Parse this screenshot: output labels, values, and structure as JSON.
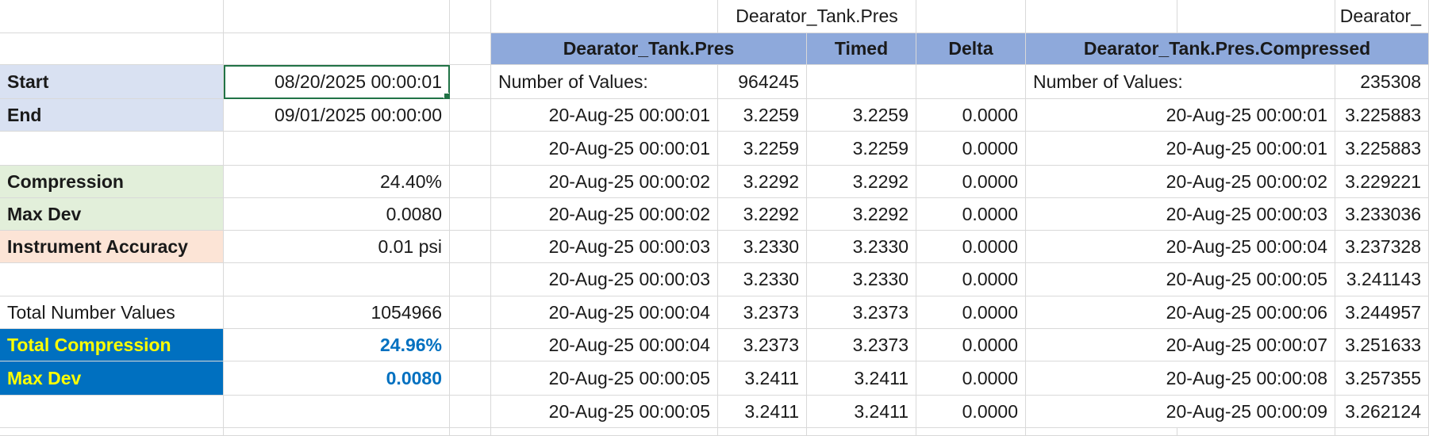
{
  "top_title_1": "Dearator_Tank.Pres",
  "top_title_2": "Dearator_",
  "headers": {
    "tag": "Dearator_Tank.Pres",
    "timed": "Timed",
    "delta": "Delta",
    "compressed": "Dearator_Tank.Pres.Compressed"
  },
  "summary": {
    "start_label": "Start",
    "start_value": "08/20/2025 00:00:01",
    "end_label": "End",
    "end_value": "09/01/2025 00:00:00",
    "compression_label": "Compression",
    "compression_value": "24.40%",
    "maxdev_label": "Max Dev",
    "maxdev_value": "0.0080",
    "accuracy_label": "Instrument Accuracy",
    "accuracy_value": "0.01 psi",
    "total_values_label": "Total Number Values",
    "total_values_value": "1054966",
    "total_compression_label": "Total Compression",
    "total_compression_value": "24.96%",
    "total_maxdev_label": "Max Dev",
    "total_maxdev_value": "0.0080"
  },
  "counts": {
    "label": "Number of Values:",
    "raw": "964245",
    "compressed_label": "Number of Values:",
    "compressed": "235308"
  },
  "rows": [
    {
      "ts": "20-Aug-25 00:00:01",
      "val": "3.2259",
      "timed": "3.2259",
      "delta": "0.0000",
      "cts": "20-Aug-25 00:00:01",
      "cval": "3.225883"
    },
    {
      "ts": "20-Aug-25 00:00:01",
      "val": "3.2259",
      "timed": "3.2259",
      "delta": "0.0000",
      "cts": "20-Aug-25 00:00:01",
      "cval": "3.225883"
    },
    {
      "ts": "20-Aug-25 00:00:02",
      "val": "3.2292",
      "timed": "3.2292",
      "delta": "0.0000",
      "cts": "20-Aug-25 00:00:02",
      "cval": "3.229221"
    },
    {
      "ts": "20-Aug-25 00:00:02",
      "val": "3.2292",
      "timed": "3.2292",
      "delta": "0.0000",
      "cts": "20-Aug-25 00:00:03",
      "cval": "3.233036"
    },
    {
      "ts": "20-Aug-25 00:00:03",
      "val": "3.2330",
      "timed": "3.2330",
      "delta": "0.0000",
      "cts": "20-Aug-25 00:00:04",
      "cval": "3.237328"
    },
    {
      "ts": "20-Aug-25 00:00:03",
      "val": "3.2330",
      "timed": "3.2330",
      "delta": "0.0000",
      "cts": "20-Aug-25 00:00:05",
      "cval": "3.241143"
    },
    {
      "ts": "20-Aug-25 00:00:04",
      "val": "3.2373",
      "timed": "3.2373",
      "delta": "0.0000",
      "cts": "20-Aug-25 00:00:06",
      "cval": "3.244957"
    },
    {
      "ts": "20-Aug-25 00:00:04",
      "val": "3.2373",
      "timed": "3.2373",
      "delta": "0.0000",
      "cts": "20-Aug-25 00:00:07",
      "cval": "3.251633"
    },
    {
      "ts": "20-Aug-25 00:00:05",
      "val": "3.2411",
      "timed": "3.2411",
      "delta": "0.0000",
      "cts": "20-Aug-25 00:00:08",
      "cval": "3.257355"
    },
    {
      "ts": "20-Aug-25 00:00:05",
      "val": "3.2411",
      "timed": "3.2411",
      "delta": "0.0000",
      "cts": "20-Aug-25 00:00:09",
      "cval": "3.262124"
    }
  ]
}
